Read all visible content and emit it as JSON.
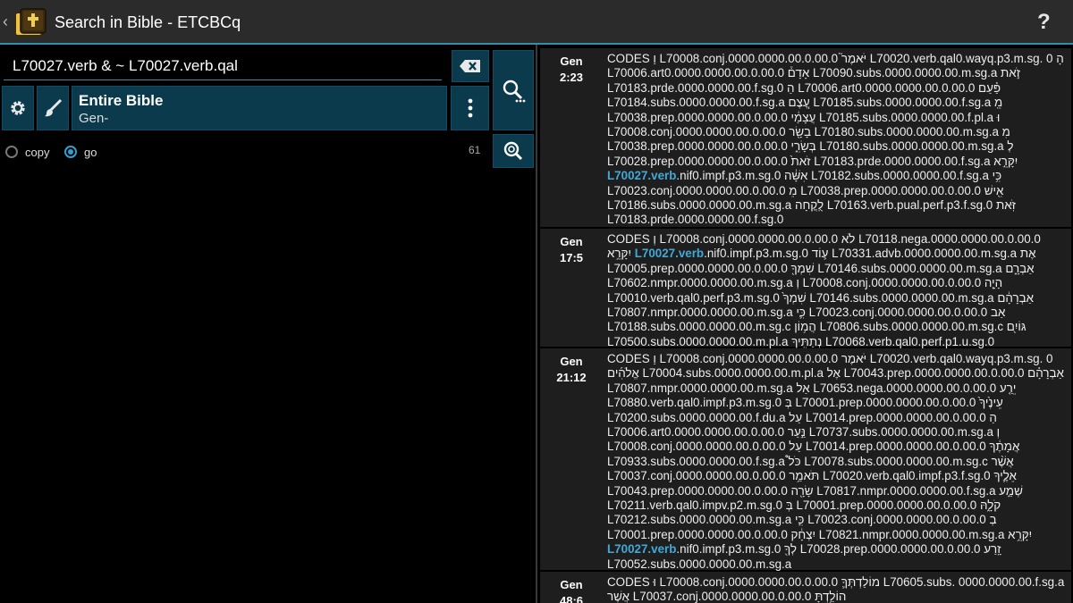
{
  "app": {
    "title": "Search in Bible - ETCBCq",
    "help_label": "?",
    "icons": {
      "back": "chevron-left-icon",
      "logo": "bible-book-icon"
    }
  },
  "search": {
    "query": "L70027.verb & ~ L70027.verb.qal",
    "scope_title": "Entire Bible",
    "scope_subtitle": "Gen-",
    "mode_copy": "copy",
    "mode_go": "go",
    "selected_mode": "go",
    "result_count": "61"
  },
  "results": [
    {
      "book": "Gen",
      "verse": "2:23",
      "text": "CODES וַ L70008.conj.0000.0000.00.0.00.0 יֹּאמֶר֮ L70020.verb.qal0.wayq.p3.m.sg. 0 הָ L70006.art0.0000.0000.00.0.00.0 אָדָם֒ L70090.subs.0000.0000.00.m.sg.a זֹ֣את L70183.prde.0000.0000.00.f.sg.0 הַ L70006.art0.0000.0000.00.0.00.0 פַּ֗עַם L70184.subs.0000.0000.00.f.sg.a עֶ֚צֶם L70185.subs.0000.0000.00.f.sg.a מֵֽ L70038.prep.0000.0000.00.0.00.0 עֲצָמַ֔י L70185.subs.0000.0000.00.f.pl.a וּ L70008.conj.0000.0000.00.0.00.0 בָשָׂ֖ר L70180.subs.0000.0000.00.m.sg.a מִ L70038.prep.0000.0000.00.0.00.0 בְּשָׂרִ֑י L70180.subs.0000.0000.00.m.sg.a לְ L70028.prep.0000.0000.00.0.00.0 זֹאת֙ L70183.prde.0000.0000.00.f.sg.a יִקָּרֵ֣א",
      "highlight": "L70027.verb",
      "text_after": ".nif0.impf.p3.m.sg.0 אִשָּׁ֔ה L70182.subs.0000.0000.00.f.sg.a כִּ֥י L70023.conj.0000.0000.00.0.00.0 מֵ L70038.prep.0000.0000.00.0.00.0 אִ֖ישׁ L70186.subs.0000.0000.00.m.sg.a לֻֽקֳחָה L70163.verb.pual.perf.p3.f.sg.0 זֹּֽאת L70183.prde.0000.0000.00.f.sg.0"
    },
    {
      "book": "Gen",
      "verse": "17:5",
      "text": "CODES וְ L70008.conj.0000.0000.00.0.00.0 לֹא L70118.nega.0000.0000.00.0.00.0 יִקָּרֵ֥א",
      "highlight": "L70027.verb",
      "text_after": ".nif0.impf.p3.m.sg.0 ע֛וֹד L70331.advb.0000.0000.00.m.sg.a אֶת L70005.prep.0000.0000.00.0.00.0 שִׁמְךָ֖ L70146.subs.0000.0000.00.m.sg.a אַבְרָ֑ם L70602.nmpr.0000.0000.00.m.sg.a וְ L70008.conj.0000.0000.00.0.00.0 הָיָ֤ה L70010.verb.qal0.perf.p3.m.sg.0 שִׁמְךָ֙ L70146.subs.0000.0000.00.m.sg.a אַבְרָהָ֔ם L70807.nmpr.0000.0000.00.m.sg.a כִּ֛י L70023.conj.0000.0000.00.0.00.0 אַב L70188.subs.0000.0000.00.m.sg.c הֲמ֥וֹן L70806.subs.0000.0000.00.m.sg.c גּוֹיִ֖ם L70500.subs.0000.0000.00.m.pl.a נְתַתִּֽיךָ L70068.verb.qal0.perf.p1.u.sg.0"
    },
    {
      "book": "Gen",
      "verse": "21:12",
      "text": "CODES וַ L70008.conj.0000.0000.00.0.00.0 יֹּאמֶר L70020.verb.qal0.wayq.p3.m.sg. 0 אֱלֹהִ֜ים L70004.subs.0000.0000.00.m.pl.a אֶל L70043.prep.0000.0000.00.0.00.0 אַבְרָהָ֗ם L70807.nmpr.0000.0000.00.m.sg.a אַל L70653.nega.0000.0000.00.0.00.0 יֵרַ֤ע L70880.verb.qal0.impf.p3.m.sg.0 בְּ L70001.prep.0000.0000.00.0.00.0 עֵינֶ֙יךָ֙ L70200.subs.0000.0000.00.f.du.a עַל L70014.prep.0000.0000.00.0.00.0 הַ L70006.art0.0000.0000.00.0.00.0 נַּ֣עַר L70737.subs.0000.0000.00.m.sg.a וְ L70008.conj.0000.0000.00.0.00.0 עַל L70014.prep.0000.0000.00.0.00.0 אֲמָתֶ֔ךָ L70933.subs.0000.0000.00.f.sg.a כֹּל֩ L70078.subs.0000.0000.00.m.sg.c אֲשֶׁ֨ר L70037.conj.0000.0000.00.0.00.0 תֹּאמַ֥ר L70020.verb.qal0.impf.p3.f.sg.0 אֵלֶ֛יךָ L70043.prep.0000.0000.00.0.00.0 שָׂרָ֖ה L70817.nmpr.0000.0000.00.f.sg.a שְׁמַ֣ע L70211.verb.qal0.impv.p2.m.sg.0 בְּ L70001.prep.0000.0000.00.0.00.0 קֹלָ֑הּ L70212.subs.0000.0000.00.m.sg.a כִּ֣י L70023.conj.0000.0000.00.0.00.0 בְ L70001.prep.0000.0000.00.0.00.0 יִצְחָ֔ק L70821.nmpr.0000.0000.00.m.sg.a יִקָּרֵ֥א",
      "highlight": "L70027.verb",
      "text_after": ".nif0.impf.p3.m.sg.0 לְךָ֖ L70028.prep.0000.0000.00.0.00.0 זָֽרַע L70052.subs.0000.0000.00.m.sg.a"
    },
    {
      "book": "Gen",
      "verse": "48:6",
      "text": "CODES וּ L70008.conj.0000.0000.00.0.00.0 מוֹלַדְתְּךָ֛ L70605.subs. 0000.0000.00.f.sg.a אֲשֶׁר L70037.conj.0000.0000.00.0.00.0 הוֹלַ֥דְתָּ",
      "highlight": "",
      "text_after": ""
    }
  ]
}
